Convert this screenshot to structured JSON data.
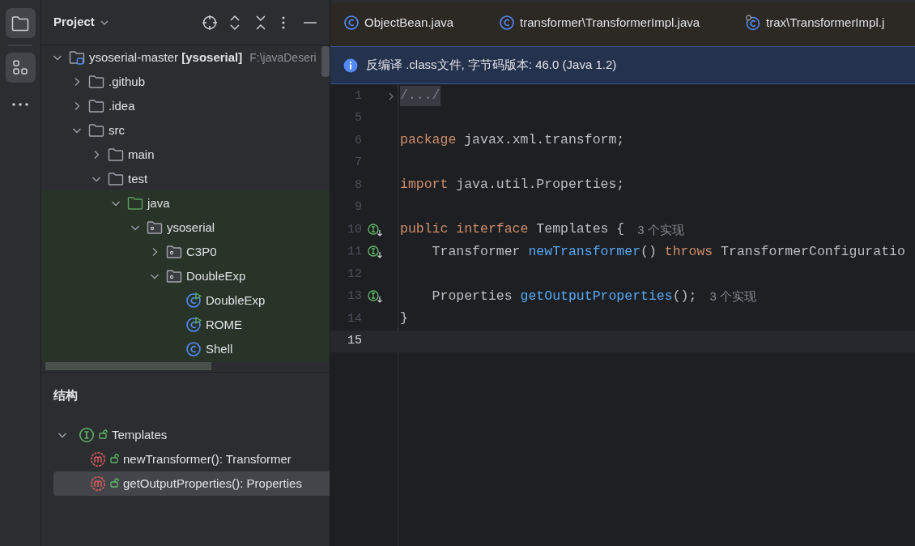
{
  "tool_strip": [
    {
      "kind": "project",
      "selected": true
    },
    {
      "kind": "structure",
      "selected": true
    },
    {
      "kind": "more",
      "selected": false
    }
  ],
  "project_panel": {
    "title": "Project",
    "tree": [
      {
        "name": "ysoserial-master **[ysoserial]**",
        "path": "F:\\javaDeseri",
        "kind": "module",
        "expanded": true,
        "children": [
          {
            "name": ".github",
            "kind": "folder",
            "expanded": false
          },
          {
            "name": ".idea",
            "kind": "folder",
            "expanded": false
          },
          {
            "name": "src",
            "kind": "folder",
            "expanded": true,
            "children": [
              {
                "name": "main",
                "kind": "folder",
                "expanded": false
              },
              {
                "name": "test",
                "kind": "folder",
                "expanded": true,
                "children": [
                  {
                    "name": "java",
                    "kind": "test-root",
                    "expanded": true,
                    "children": [
                      {
                        "name": "ysoserial",
                        "kind": "package",
                        "expanded": true,
                        "children": [
                          {
                            "name": "C3P0",
                            "kind": "package",
                            "expanded": false
                          },
                          {
                            "name": "DoubleExp",
                            "kind": "package",
                            "expanded": true,
                            "children": [
                              {
                                "name": "DoubleExp",
                                "kind": "class-run"
                              },
                              {
                                "name": "ROME",
                                "kind": "class-run"
                              },
                              {
                                "name": "Shell",
                                "kind": "class"
                              }
                            ]
                          }
                        ]
                      }
                    ]
                  }
                ]
              }
            ]
          }
        ]
      }
    ]
  },
  "structure_panel": {
    "title": "结构",
    "tree": [
      {
        "name": "Templates",
        "kind": "interface",
        "expanded": true,
        "selected": false,
        "children": [
          {
            "name": "newTransformer(): Transformer",
            "kind": "method",
            "selected": false
          },
          {
            "name": "getOutputProperties(): Properties",
            "kind": "method",
            "selected": true
          }
        ]
      }
    ]
  },
  "editor": {
    "tabs": [
      {
        "label": "ObjectBean.java",
        "kind": "class"
      },
      {
        "label": "transformer\\TransformerImpl.java",
        "kind": "class"
      },
      {
        "label": "trax\\TransformerImpl.j",
        "kind": "class-linked"
      }
    ],
    "banner": "反编译 .class文件, 字节码版本: 46.0 (Java 1.2)",
    "lines": [
      {
        "number": "1",
        "fold": true,
        "marker": false,
        "current": false,
        "tokens": [
          {
            "kind": "folded",
            "text": "/.../"
          }
        ]
      },
      {
        "number": "5",
        "fold": false,
        "marker": false,
        "current": false
      },
      {
        "number": "6",
        "fold": false,
        "marker": false,
        "current": false,
        "tokens": [
          {
            "kind": "keyword",
            "text": "package "
          },
          {
            "kind": "plain",
            "text": "javax.xml.transform;"
          }
        ]
      },
      {
        "number": "7",
        "fold": false,
        "marker": false,
        "current": false
      },
      {
        "number": "8",
        "fold": false,
        "marker": false,
        "current": false,
        "tokens": [
          {
            "kind": "keyword",
            "text": "import "
          },
          {
            "kind": "plain",
            "text": "java.util.Properties;"
          }
        ]
      },
      {
        "number": "9",
        "fold": false,
        "marker": false,
        "current": false
      },
      {
        "number": "10",
        "fold": false,
        "marker": true,
        "current": false,
        "tokens": [
          {
            "kind": "keyword",
            "text": "public interface "
          },
          {
            "kind": "plain",
            "text": "Templates {"
          },
          {
            "kind": "hint",
            "text": "3 个实现"
          }
        ]
      },
      {
        "number": "11",
        "fold": false,
        "marker": true,
        "current": false,
        "tokens": [
          {
            "kind": "plain",
            "text": "    Transformer "
          },
          {
            "kind": "method",
            "text": "newTransformer"
          },
          {
            "kind": "plain",
            "text": "() "
          },
          {
            "kind": "keyword",
            "text": "throws "
          },
          {
            "kind": "plain",
            "text": "TransformerConfiguratio"
          }
        ]
      },
      {
        "number": "12",
        "fold": false,
        "marker": false,
        "current": false
      },
      {
        "number": "13",
        "fold": false,
        "marker": true,
        "current": false,
        "tokens": [
          {
            "kind": "plain",
            "text": "    Properties "
          },
          {
            "kind": "method",
            "text": "getOutputProperties"
          },
          {
            "kind": "plain",
            "text": "();"
          },
          {
            "kind": "hint",
            "text": "3 个实现"
          }
        ]
      },
      {
        "number": "14",
        "fold": false,
        "marker": false,
        "current": false,
        "tokens": [
          {
            "kind": "plain",
            "text": "}"
          }
        ]
      },
      {
        "number": "15",
        "fold": false,
        "marker": false,
        "current": true
      }
    ]
  }
}
